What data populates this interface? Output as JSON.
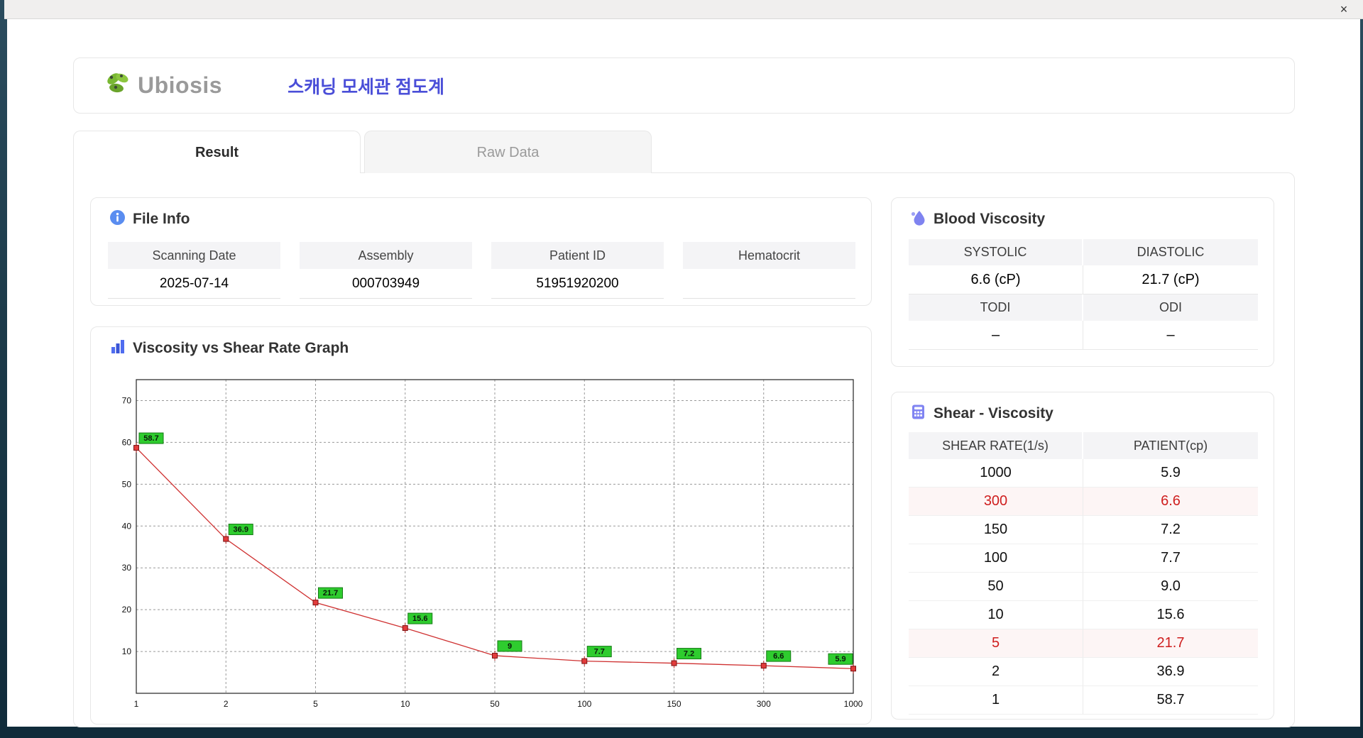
{
  "window": {
    "close_label": "×"
  },
  "header": {
    "logo_text": "Ubiosis",
    "title": "스캐닝 모세관 점도계"
  },
  "tabs": [
    {
      "label": "Result",
      "active": true
    },
    {
      "label": "Raw Data",
      "active": false
    }
  ],
  "file_info": {
    "title": "File Info",
    "fields": [
      {
        "label": "Scanning Date",
        "value": "2025-07-14"
      },
      {
        "label": "Assembly",
        "value": "000703949"
      },
      {
        "label": "Patient ID",
        "value": "51951920200"
      },
      {
        "label": "Hematocrit",
        "value": ""
      }
    ]
  },
  "blood_viscosity": {
    "title": "Blood Viscosity",
    "rows": [
      {
        "labels": [
          "SYSTOLIC",
          "DIASTOLIC"
        ],
        "values": [
          "6.6 (cP)",
          "21.7 (cP)"
        ]
      },
      {
        "labels": [
          "TODI",
          "ODI"
        ],
        "values": [
          "–",
          "–"
        ]
      }
    ]
  },
  "shear_viscosity": {
    "title": "Shear - Viscosity",
    "columns": [
      "SHEAR RATE(1/s)",
      "PATIENT(cp)"
    ],
    "rows": [
      {
        "shear": "1000",
        "patient": "5.9",
        "highlight": false
      },
      {
        "shear": "300",
        "patient": "6.6",
        "highlight": true
      },
      {
        "shear": "150",
        "patient": "7.2",
        "highlight": false
      },
      {
        "shear": "100",
        "patient": "7.7",
        "highlight": false
      },
      {
        "shear": "50",
        "patient": "9.0",
        "highlight": false
      },
      {
        "shear": "10",
        "patient": "15.6",
        "highlight": false
      },
      {
        "shear": "5",
        "patient": "21.7",
        "highlight": true
      },
      {
        "shear": "2",
        "patient": "36.9",
        "highlight": false
      },
      {
        "shear": "1",
        "patient": "58.7",
        "highlight": false
      }
    ]
  },
  "graph": {
    "title": "Viscosity vs Shear Rate Graph"
  },
  "chart_data": {
    "type": "line",
    "title": "Viscosity vs Shear Rate Graph",
    "x_labels": [
      "1",
      "2",
      "5",
      "10",
      "50",
      "100",
      "150",
      "300",
      "1000"
    ],
    "values": [
      58.7,
      36.9,
      21.7,
      15.6,
      9,
      7.7,
      7.2,
      6.6,
      5.9
    ],
    "point_labels": [
      "58.7",
      "36.9",
      "21.7",
      "15.6",
      "9",
      "7.7",
      "7.2",
      "6.6",
      "5.9"
    ],
    "xlabel": "",
    "ylabel": "",
    "ylim": [
      0,
      75
    ],
    "yticks": [
      10,
      20,
      30,
      40,
      50,
      60,
      70
    ],
    "grid": "dashed",
    "line_color": "#cf3131",
    "marker_fill": "#e23b3b",
    "marker_stroke": "#7a1515",
    "label_bg": "#2ecc2e",
    "label_border": "#157a15",
    "axis_color": "#333333",
    "grid_color": "#999999"
  },
  "colors": {
    "accent_blue": "#4a4ed8",
    "highlight_red": "#cf1f1f",
    "header_bg": "#f4f4f6"
  }
}
